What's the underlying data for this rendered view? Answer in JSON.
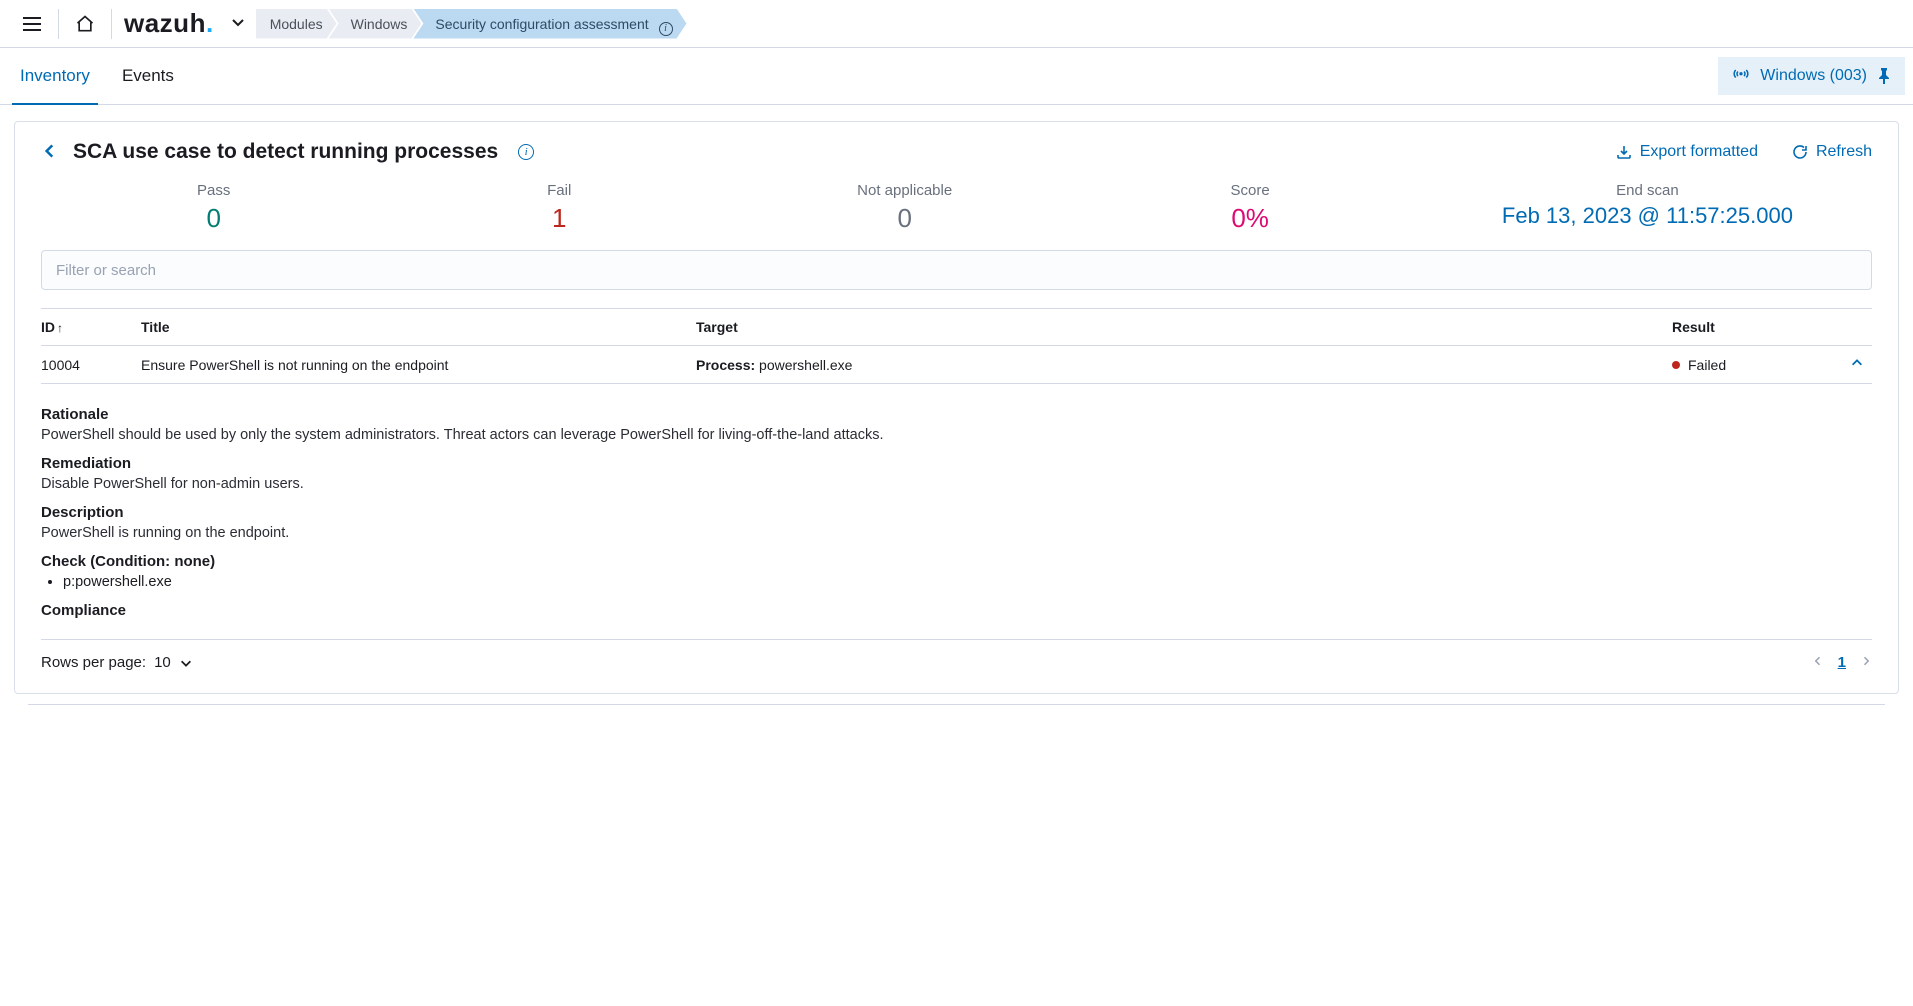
{
  "header": {
    "logo_text": "wazuh",
    "logo_dot": ".",
    "breadcrumbs": [
      {
        "label": "Modules",
        "active": false
      },
      {
        "label": "Windows",
        "active": false
      },
      {
        "label": "Security configuration assessment",
        "active": true,
        "has_info": true
      }
    ]
  },
  "tabs": {
    "items": [
      "Inventory",
      "Events"
    ],
    "active_index": 0
  },
  "agent_badge": {
    "label": "Windows (003)"
  },
  "panel": {
    "title": "SCA use case to detect running processes",
    "actions": {
      "export_label": "Export formatted",
      "refresh_label": "Refresh"
    }
  },
  "stats": {
    "pass": {
      "label": "Pass",
      "value": "0"
    },
    "fail": {
      "label": "Fail",
      "value": "1"
    },
    "na": {
      "label": "Not applicable",
      "value": "0"
    },
    "score": {
      "label": "Score",
      "value": "0%"
    },
    "end": {
      "label": "End scan",
      "value": "Feb 13, 2023 @ 11:57:25.000"
    }
  },
  "search": {
    "placeholder": "Filter or search"
  },
  "table": {
    "columns": {
      "id": "ID",
      "title": "Title",
      "target": "Target",
      "result": "Result"
    },
    "rows": [
      {
        "id": "10004",
        "title": "Ensure PowerShell is not running on the endpoint",
        "target_label": "Process:",
        "target_value": "powershell.exe",
        "result": "Failed"
      }
    ]
  },
  "detail": {
    "rationale": {
      "heading": "Rationale",
      "text": "PowerShell should be used by only the system administrators. Threat actors can leverage PowerShell for living-off-the-land attacks."
    },
    "remediation": {
      "heading": "Remediation",
      "text": "Disable PowerShell for non-admin users."
    },
    "description": {
      "heading": "Description",
      "text": "PowerShell is running on the endpoint."
    },
    "check": {
      "heading": "Check (Condition: none)",
      "items": [
        "p:powershell.exe"
      ]
    },
    "compliance": {
      "heading": "Compliance"
    }
  },
  "footer": {
    "rows_per_page_label": "Rows per page:",
    "rows_per_page_value": "10",
    "current_page": "1"
  }
}
